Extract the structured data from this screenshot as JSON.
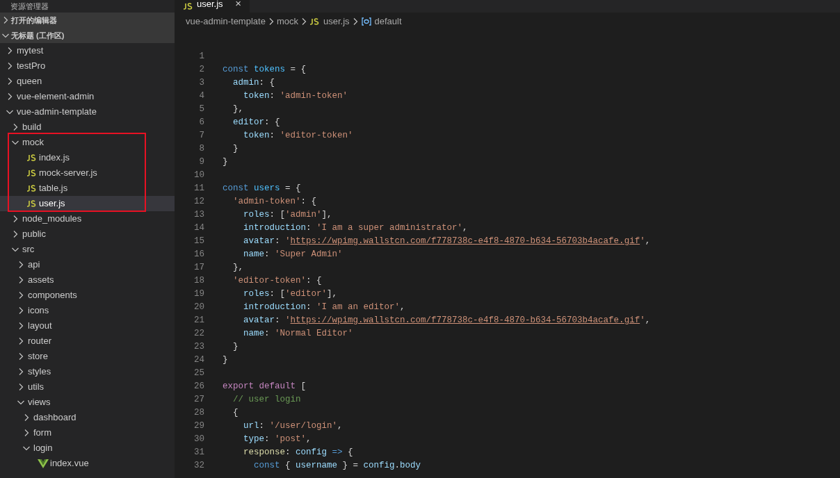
{
  "explorer": {
    "title": "资源管理器",
    "sections": [
      {
        "label": "打开的编辑器",
        "expanded": false
      },
      {
        "label": "无标题 (工作区)",
        "expanded": true
      }
    ],
    "tree": [
      {
        "label": "mytest",
        "kind": "folder",
        "expanded": false,
        "selected": false
      },
      {
        "label": "testPro",
        "kind": "folder",
        "expanded": false,
        "selected": false
      },
      {
        "label": "queen",
        "kind": "folder",
        "expanded": false,
        "selected": false
      },
      {
        "label": "vue-element-admin",
        "kind": "folder",
        "expanded": false,
        "selected": false
      },
      {
        "label": "vue-admin-template",
        "kind": "folder",
        "expanded": true,
        "selected": false,
        "children": [
          {
            "label": "build",
            "kind": "folder",
            "expanded": false,
            "selected": false
          },
          {
            "label": "mock",
            "kind": "folder",
            "expanded": true,
            "selected": false,
            "annotated": true,
            "children": [
              {
                "label": "index.js",
                "kind": "js",
                "selected": false
              },
              {
                "label": "mock-server.js",
                "kind": "js",
                "selected": false
              },
              {
                "label": "table.js",
                "kind": "js",
                "selected": false
              },
              {
                "label": "user.js",
                "kind": "js",
                "selected": true
              }
            ]
          },
          {
            "label": "node_modules",
            "kind": "folder",
            "expanded": false,
            "selected": false
          },
          {
            "label": "public",
            "kind": "folder",
            "expanded": false,
            "selected": false
          },
          {
            "label": "src",
            "kind": "folder",
            "expanded": true,
            "selected": false,
            "children": [
              {
                "label": "api",
                "kind": "folder",
                "expanded": false,
                "selected": false
              },
              {
                "label": "assets",
                "kind": "folder",
                "expanded": false,
                "selected": false
              },
              {
                "label": "components",
                "kind": "folder",
                "expanded": false,
                "selected": false
              },
              {
                "label": "icons",
                "kind": "folder",
                "expanded": false,
                "selected": false
              },
              {
                "label": "layout",
                "kind": "folder",
                "expanded": false,
                "selected": false
              },
              {
                "label": "router",
                "kind": "folder",
                "expanded": false,
                "selected": false
              },
              {
                "label": "store",
                "kind": "folder",
                "expanded": false,
                "selected": false
              },
              {
                "label": "styles",
                "kind": "folder",
                "expanded": false,
                "selected": false
              },
              {
                "label": "utils",
                "kind": "folder",
                "expanded": false,
                "selected": false
              },
              {
                "label": "views",
                "kind": "folder",
                "expanded": true,
                "selected": false,
                "children": [
                  {
                    "label": "dashboard",
                    "kind": "folder",
                    "expanded": false,
                    "selected": false
                  },
                  {
                    "label": "form",
                    "kind": "folder",
                    "expanded": false,
                    "selected": false
                  },
                  {
                    "label": "login",
                    "kind": "folder",
                    "expanded": true,
                    "selected": false,
                    "children": [
                      {
                        "label": "index.vue",
                        "kind": "vue",
                        "selected": false
                      }
                    ]
                  }
                ]
              }
            ]
          }
        ]
      }
    ]
  },
  "tabs": [
    {
      "label": "user.js",
      "kind": "js",
      "selected": true,
      "close": "×"
    }
  ],
  "breadcrumb": [
    {
      "label": "vue-admin-template",
      "kind": "folder"
    },
    {
      "label": "mock",
      "kind": "folder"
    },
    {
      "label": "user.js",
      "kind": "js"
    },
    {
      "label": "default",
      "kind": "symbol"
    }
  ],
  "code": [
    {
      "n": "1"
    },
    {
      "n": "2",
      "tokens": [
        {
          "kind": "kw",
          "text": "const "
        },
        {
          "kind": "var",
          "text": "tokens"
        },
        {
          "kind": "p",
          "text": " = {"
        }
      ]
    },
    {
      "n": "3",
      "tokens": [
        {
          "kind": "prop",
          "text": "  admin"
        },
        {
          "kind": "p",
          "text": ": {"
        }
      ]
    },
    {
      "n": "4",
      "tokens": [
        {
          "kind": "prop",
          "text": "    token"
        },
        {
          "kind": "p",
          "text": ": "
        },
        {
          "kind": "str",
          "text": "'admin-token'"
        }
      ]
    },
    {
      "n": "5",
      "tokens": [
        {
          "kind": "p",
          "text": "  },"
        }
      ]
    },
    {
      "n": "6",
      "tokens": [
        {
          "kind": "prop",
          "text": "  editor"
        },
        {
          "kind": "p",
          "text": ": {"
        }
      ]
    },
    {
      "n": "7",
      "tokens": [
        {
          "kind": "prop",
          "text": "    token"
        },
        {
          "kind": "p",
          "text": ": "
        },
        {
          "kind": "str",
          "text": "'editor-token'"
        }
      ]
    },
    {
      "n": "8",
      "tokens": [
        {
          "kind": "p",
          "text": "  }"
        }
      ]
    },
    {
      "n": "9",
      "tokens": [
        {
          "kind": "p",
          "text": "}"
        }
      ]
    },
    {
      "n": "10"
    },
    {
      "n": "11",
      "tokens": [
        {
          "kind": "kw",
          "text": "const "
        },
        {
          "kind": "var",
          "text": "users"
        },
        {
          "kind": "p",
          "text": " = {"
        }
      ]
    },
    {
      "n": "12",
      "tokens": [
        {
          "kind": "str",
          "text": "  'admin-token'"
        },
        {
          "kind": "p",
          "text": ": {"
        }
      ]
    },
    {
      "n": "13",
      "tokens": [
        {
          "kind": "prop",
          "text": "    roles"
        },
        {
          "kind": "p",
          "text": ": ["
        },
        {
          "kind": "str",
          "text": "'admin'"
        },
        {
          "kind": "p",
          "text": "],"
        }
      ]
    },
    {
      "n": "14",
      "tokens": [
        {
          "kind": "prop",
          "text": "    introduction"
        },
        {
          "kind": "p",
          "text": ": "
        },
        {
          "kind": "str",
          "text": "'I am a super administrator'"
        },
        {
          "kind": "p",
          "text": ","
        }
      ]
    },
    {
      "n": "15",
      "tokens": [
        {
          "kind": "prop",
          "text": "    avatar"
        },
        {
          "kind": "p",
          "text": ": "
        },
        {
          "kind": "str",
          "text": "'"
        },
        {
          "kind": "link",
          "text": "https://wpimg.wallstcn.com/f778738c-e4f8-4870-b634-56703b4acafe.gif"
        },
        {
          "kind": "str",
          "text": "'"
        },
        {
          "kind": "p",
          "text": ","
        }
      ]
    },
    {
      "n": "16",
      "tokens": [
        {
          "kind": "prop",
          "text": "    name"
        },
        {
          "kind": "p",
          "text": ": "
        },
        {
          "kind": "str",
          "text": "'Super Admin'"
        }
      ]
    },
    {
      "n": "17",
      "tokens": [
        {
          "kind": "p",
          "text": "  },"
        }
      ]
    },
    {
      "n": "18",
      "tokens": [
        {
          "kind": "str",
          "text": "  'editor-token'"
        },
        {
          "kind": "p",
          "text": ": {"
        }
      ]
    },
    {
      "n": "19",
      "tokens": [
        {
          "kind": "prop",
          "text": "    roles"
        },
        {
          "kind": "p",
          "text": ": ["
        },
        {
          "kind": "str",
          "text": "'editor'"
        },
        {
          "kind": "p",
          "text": "],"
        }
      ]
    },
    {
      "n": "20",
      "tokens": [
        {
          "kind": "prop",
          "text": "    introduction"
        },
        {
          "kind": "p",
          "text": ": "
        },
        {
          "kind": "str",
          "text": "'I am an editor'"
        },
        {
          "kind": "p",
          "text": ","
        }
      ]
    },
    {
      "n": "21",
      "tokens": [
        {
          "kind": "prop",
          "text": "    avatar"
        },
        {
          "kind": "p",
          "text": ": "
        },
        {
          "kind": "str",
          "text": "'"
        },
        {
          "kind": "link",
          "text": "https://wpimg.wallstcn.com/f778738c-e4f8-4870-b634-56703b4acafe.gif"
        },
        {
          "kind": "str",
          "text": "'"
        },
        {
          "kind": "p",
          "text": ","
        }
      ]
    },
    {
      "n": "22",
      "tokens": [
        {
          "kind": "prop",
          "text": "    name"
        },
        {
          "kind": "p",
          "text": ": "
        },
        {
          "kind": "str",
          "text": "'Normal Editor'"
        }
      ]
    },
    {
      "n": "23",
      "tokens": [
        {
          "kind": "p",
          "text": "  }"
        }
      ]
    },
    {
      "n": "24",
      "tokens": [
        {
          "kind": "p",
          "text": "}"
        }
      ]
    },
    {
      "n": "25"
    },
    {
      "n": "26",
      "tokens": [
        {
          "kind": "ctl",
          "text": "export default"
        },
        {
          "kind": "p",
          "text": " ["
        }
      ]
    },
    {
      "n": "27",
      "tokens": [
        {
          "kind": "cmt",
          "text": "  // user login"
        }
      ]
    },
    {
      "n": "28",
      "tokens": [
        {
          "kind": "p",
          "text": "  {"
        }
      ]
    },
    {
      "n": "29",
      "tokens": [
        {
          "kind": "prop",
          "text": "    url"
        },
        {
          "kind": "p",
          "text": ": "
        },
        {
          "kind": "str",
          "text": "'/user/login'"
        },
        {
          "kind": "p",
          "text": ","
        }
      ]
    },
    {
      "n": "30",
      "tokens": [
        {
          "kind": "prop",
          "text": "    type"
        },
        {
          "kind": "p",
          "text": ": "
        },
        {
          "kind": "str",
          "text": "'post'"
        },
        {
          "kind": "p",
          "text": ","
        }
      ]
    },
    {
      "n": "31",
      "tokens": [
        {
          "kind": "fn",
          "text": "    response"
        },
        {
          "kind": "p",
          "text": ": "
        },
        {
          "kind": "prop",
          "text": "config"
        },
        {
          "kind": "kw",
          "text": " =>"
        },
        {
          "kind": "p",
          "text": " {"
        }
      ]
    },
    {
      "n": "32",
      "tokens": [
        {
          "kind": "kw",
          "text": "      const"
        },
        {
          "kind": "p",
          "text": " { "
        },
        {
          "kind": "prop",
          "text": "username"
        },
        {
          "kind": "p",
          "text": " } = "
        },
        {
          "kind": "prop",
          "text": "config"
        },
        {
          "kind": "p",
          "text": "."
        },
        {
          "kind": "prop",
          "text": "body"
        }
      ]
    }
  ]
}
